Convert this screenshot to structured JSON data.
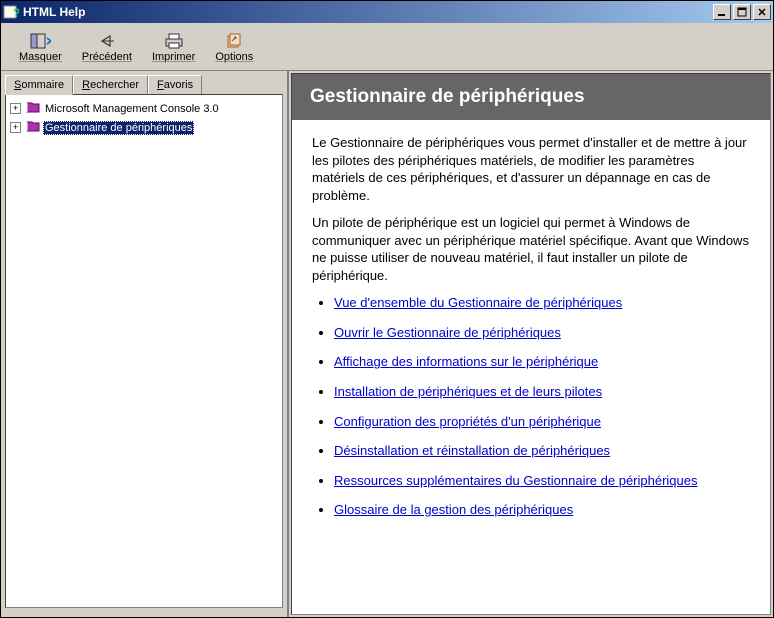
{
  "window": {
    "title": "HTML Help"
  },
  "toolbar": {
    "hide": "Masquer",
    "back": "Précédent",
    "print": "Imprimer",
    "options": "Options"
  },
  "tabs": {
    "summary": "ommaire",
    "summary_u": "S",
    "search": "echercher",
    "search_u": "R",
    "favorites": "avoris",
    "favorites_u": "F"
  },
  "tree": {
    "items": [
      {
        "label": "Microsoft Management Console 3.0",
        "selected": false
      },
      {
        "label": "Gestionnaire de périphériques",
        "selected": true
      }
    ]
  },
  "content": {
    "heading": "Gestionnaire de périphériques",
    "para1": "Le Gestionnaire de périphériques vous permet d'installer et de mettre à jour les pilotes des périphériques matériels, de modifier les paramètres matériels de ces périphériques, et d'assurer un dépannage en cas de problème.",
    "para2": "Un pilote de périphérique est un logiciel qui permet à Windows de communiquer avec un périphérique matériel spécifique. Avant que Windows ne puisse utiliser de nouveau matériel, il faut installer un pilote de périphérique.",
    "links": [
      "Vue d'ensemble du Gestionnaire de périphériques",
      "Ouvrir le Gestionnaire de périphériques",
      "Affichage des informations sur le périphérique",
      "Installation de périphériques et de leurs pilotes",
      "Configuration des propriétés d'un périphérique",
      "Désinstallation et réinstallation de périphériques",
      "Ressources supplémentaires du Gestionnaire de périphériques",
      "Glossaire de la gestion des périphériques"
    ]
  }
}
